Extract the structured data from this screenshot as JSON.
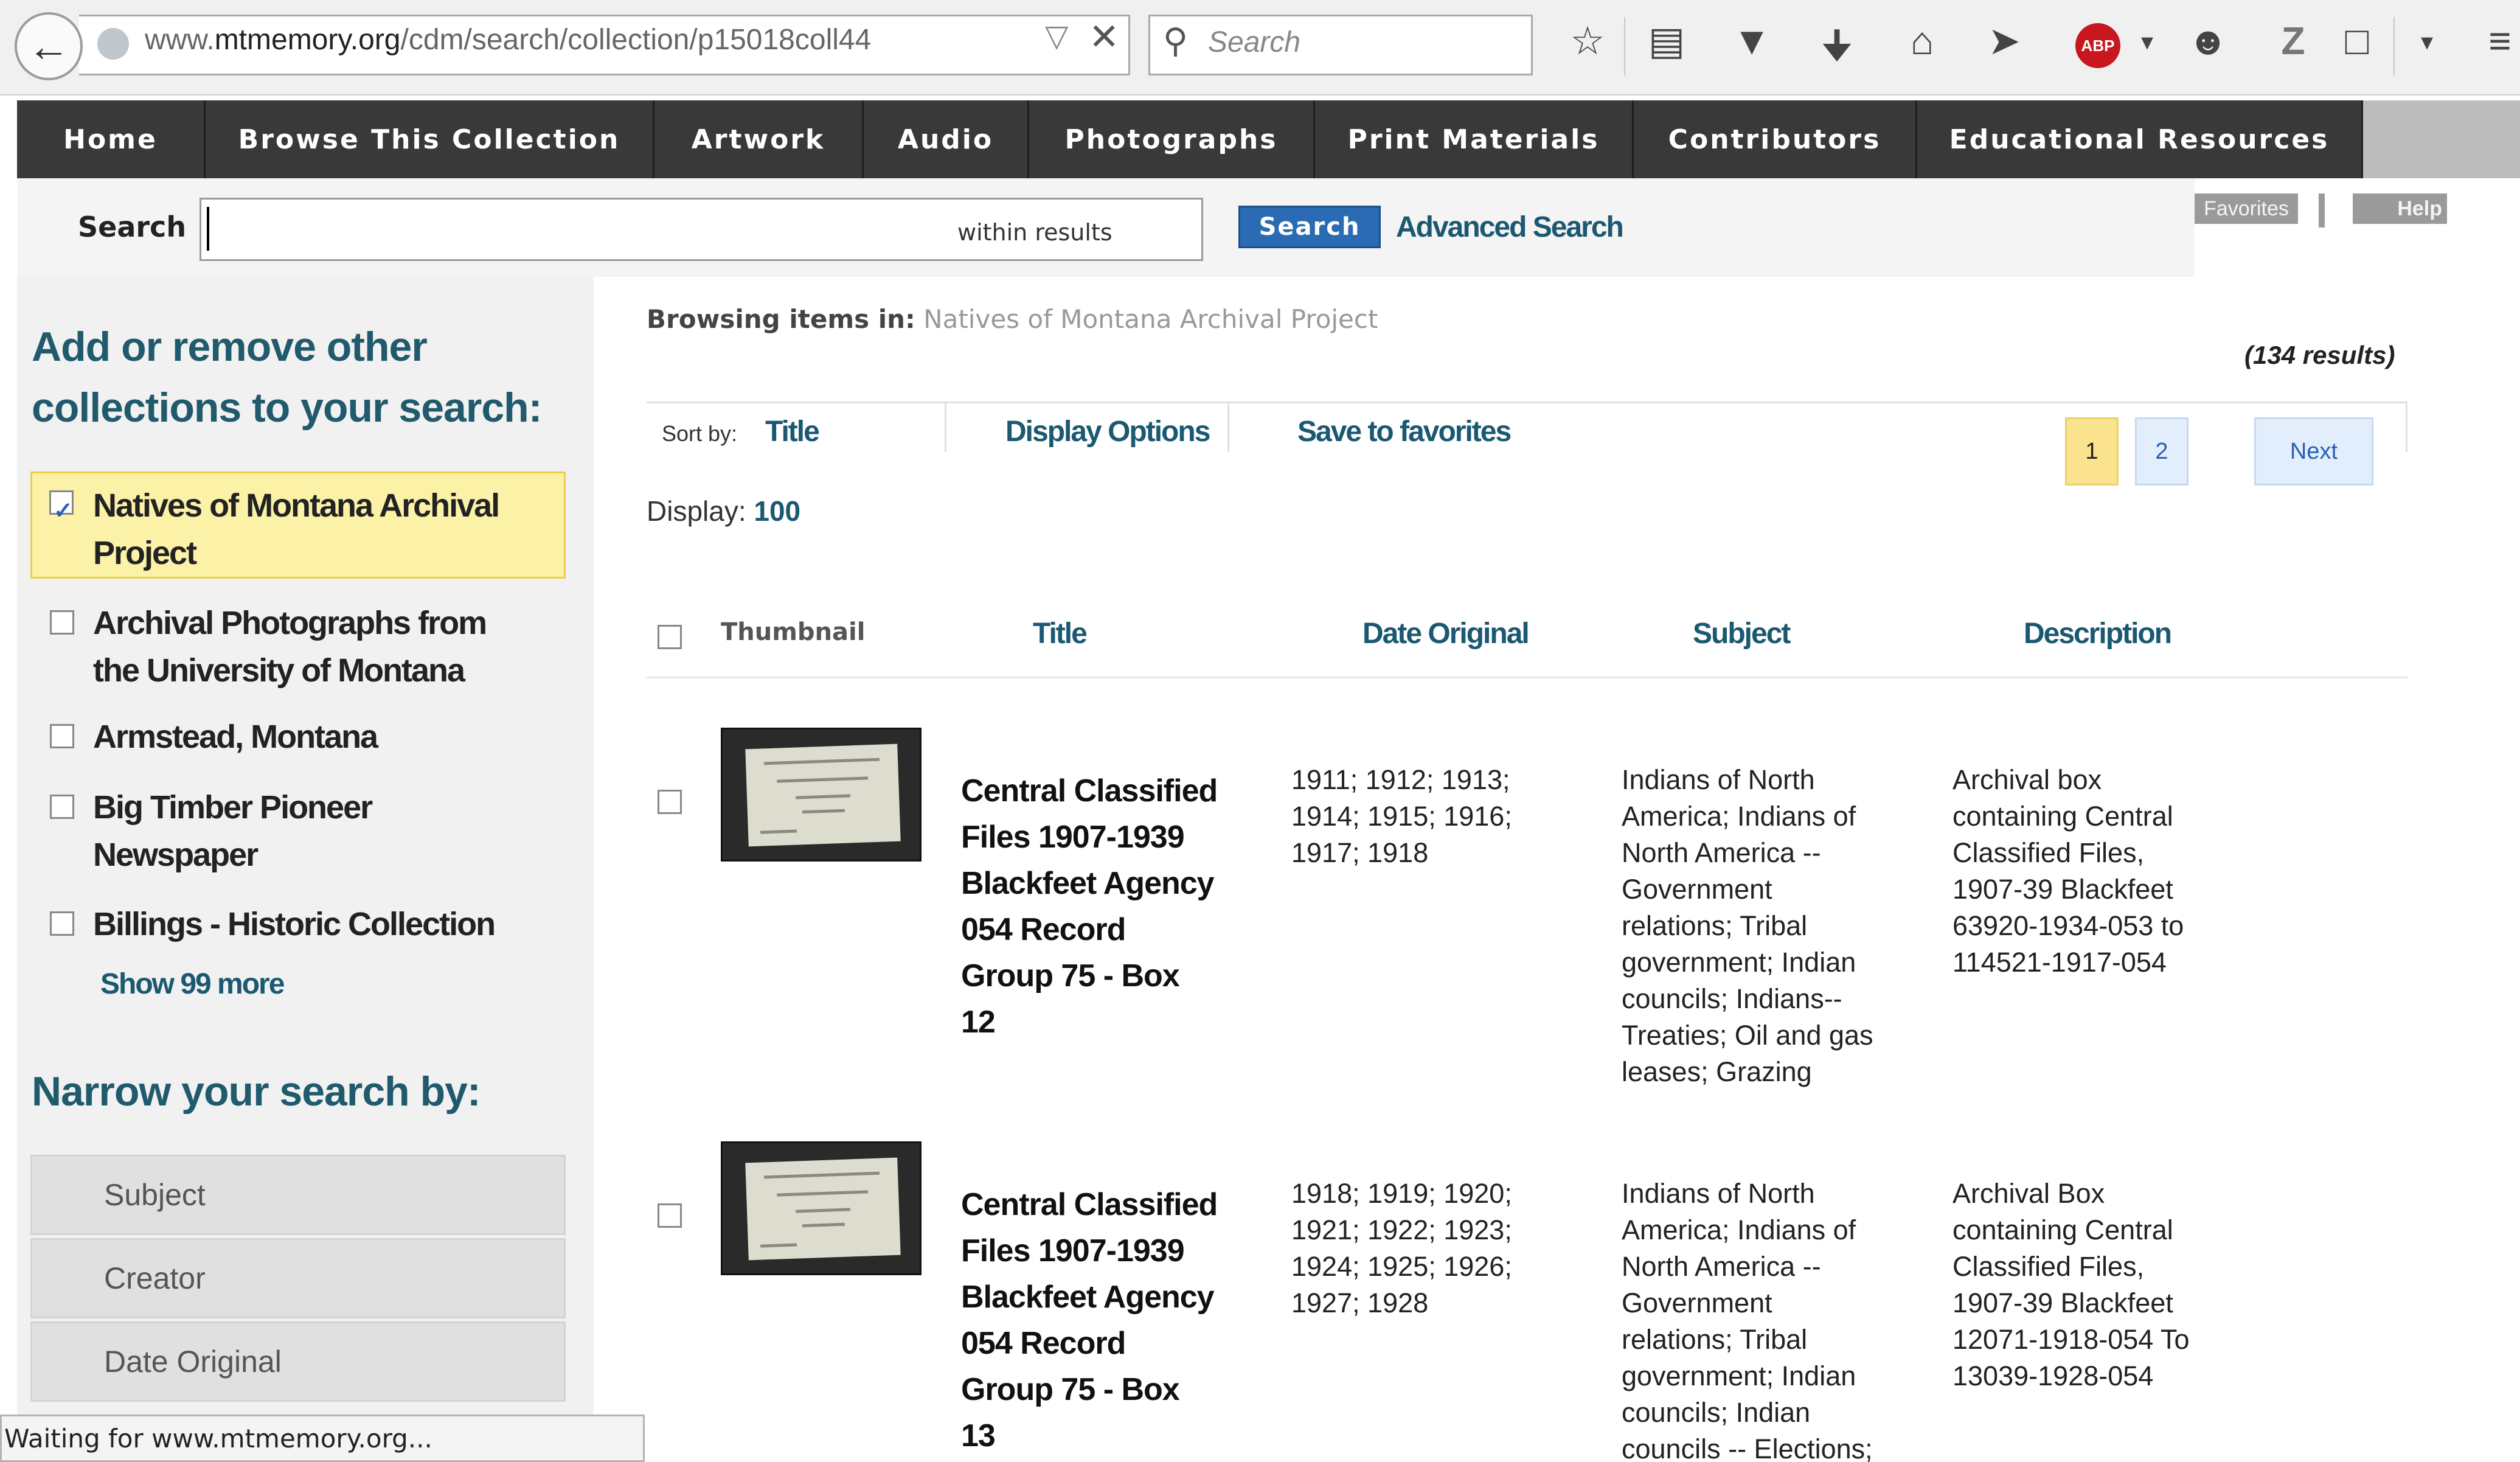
{
  "browser": {
    "url_prefix": "www.",
    "url_domain": "mtmemory.org",
    "url_path": "/cdm/search/collection/p15018coll44",
    "search_placeholder": "Search"
  },
  "nav": {
    "items": [
      "Home",
      "Browse This Collection",
      "Artwork",
      "Audio",
      "Photographs",
      "Print Materials",
      "Contributors",
      "Educational Resources"
    ]
  },
  "search": {
    "label": "Search",
    "value": "",
    "within_label": "within results",
    "button_label": "Search",
    "advanced_label": "Advanced Search",
    "favorites_label": "Favorites",
    "help_label": "Help"
  },
  "sidebar": {
    "collections_heading_line1": "Add or remove other",
    "collections_heading_line2": "collections to your search:",
    "collections": [
      {
        "line1": "Natives of Montana Archival",
        "line2": "Project",
        "checked": true
      },
      {
        "line1": "Archival Photographs from",
        "line2": "the University of Montana",
        "checked": false
      },
      {
        "line1": "Armstead, Montana",
        "line2": "",
        "checked": false
      },
      {
        "line1": "Big Timber Pioneer",
        "line2": "Newspaper",
        "checked": false
      },
      {
        "line1": "Billings - Historic Collection",
        "line2": "",
        "checked": false
      }
    ],
    "show_more": "Show 99 more",
    "narrow_heading": "Narrow your search by:",
    "facets": [
      "Subject",
      "Creator",
      "Date Original"
    ]
  },
  "main": {
    "browsing_label": "Browsing items in:",
    "browsing_collection": "Natives of Montana Archival Project",
    "results_count": "(134 results)",
    "sort_by_label": "Sort by:",
    "sort_by_value": "Title",
    "display_options": "Display Options",
    "save_to_favorites": "Save to favorites",
    "pages": [
      "1",
      "2"
    ],
    "next_label": "Next",
    "display_label": "Display:",
    "display_value": "100",
    "columns": {
      "thumbnail": "Thumbnail",
      "title": "Title",
      "date": "Date Original",
      "subject": "Subject",
      "description": "Description"
    },
    "rows": [
      {
        "title": [
          "Central Classified",
          "Files 1907-1939",
          "Blackfeet Agency",
          "054 Record",
          "Group 75 - Box",
          "12"
        ],
        "date": [
          "1911; 1912; 1913;",
          "1914; 1915; 1916;",
          "1917; 1918"
        ],
        "subject": [
          "Indians of North",
          "America; Indians of",
          "North America --",
          "Government",
          "relations; Tribal",
          "government; Indian",
          "councils; Indians--",
          "Treaties; Oil and gas",
          "leases; Grazing"
        ],
        "description": [
          "Archival box",
          "containing Central",
          "Classified Files,",
          "1907-39 Blackfeet",
          "63920-1934-053 to",
          "114521-1917-054"
        ]
      },
      {
        "title": [
          "Central Classified",
          "Files 1907-1939",
          "Blackfeet Agency",
          "054 Record",
          "Group 75 - Box",
          "13"
        ],
        "date": [
          "1918; 1919; 1920;",
          "1921; 1922; 1923;",
          "1924; 1925; 1926;",
          "1927; 1928"
        ],
        "subject": [
          "Indians of North",
          "America; Indians of",
          "North America --",
          "Government",
          "relations; Tribal",
          "government; Indian",
          "councils; Indian",
          "councils -- Elections;"
        ],
        "description": [
          "Archival Box",
          "containing Central",
          "Classified Files,",
          "1907-39 Blackfeet",
          "12071-1918-054 To",
          "13039-1928-054"
        ]
      }
    ]
  },
  "status_bar": "Waiting for www.mtmemory.org...",
  "colors": {
    "nav_bg": "#393939",
    "link": "#1b5872",
    "heading": "#205a6c",
    "selected_bg": "#fbf2a8",
    "search_button": "#2b6bb3"
  }
}
